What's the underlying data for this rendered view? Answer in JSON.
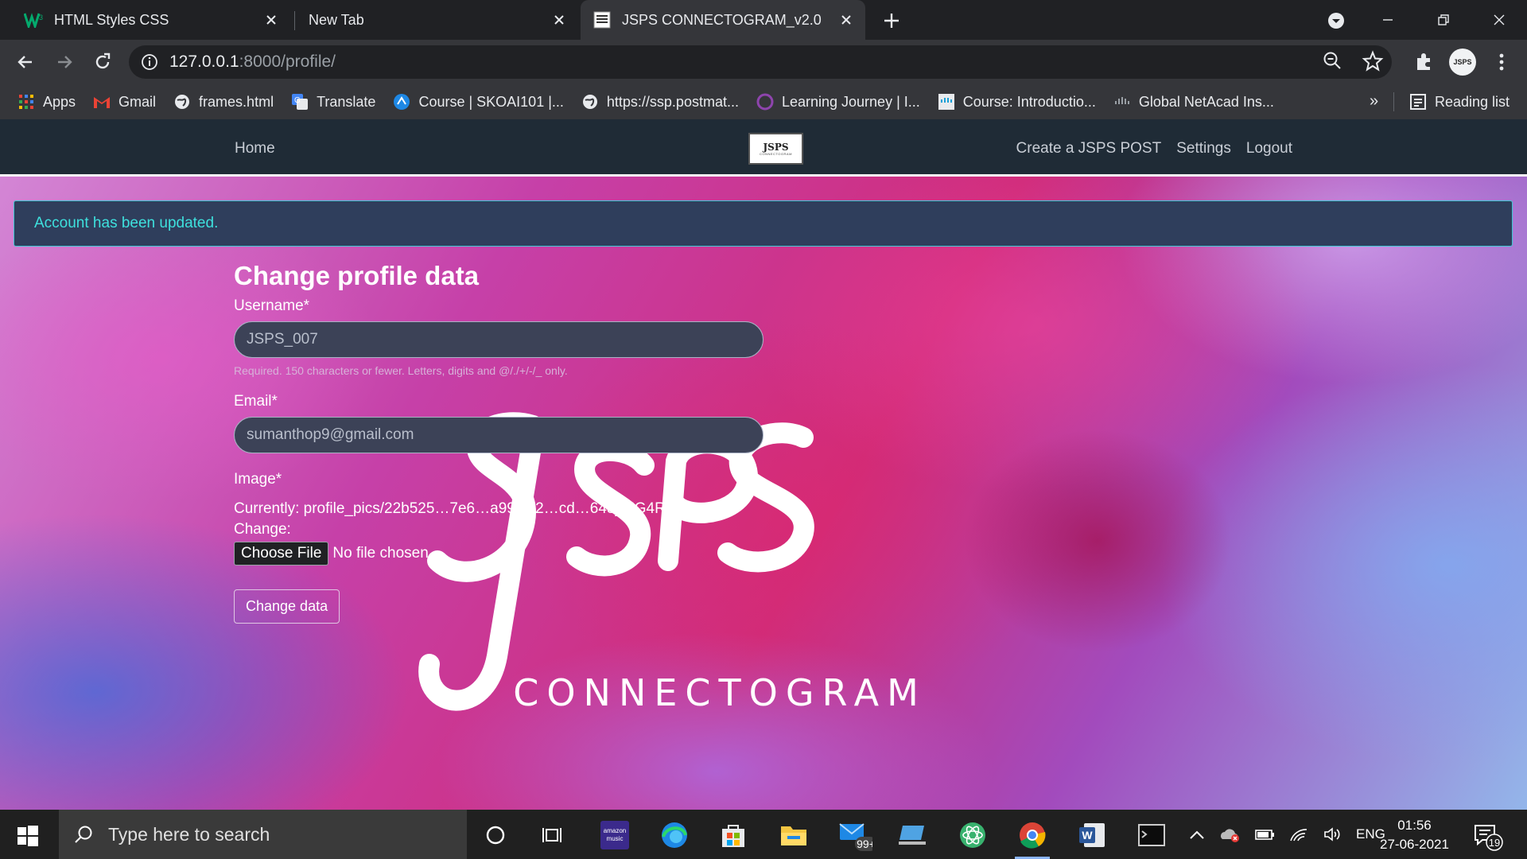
{
  "browser": {
    "tabs": [
      {
        "title": "HTML Styles CSS"
      },
      {
        "title": "New Tab"
      },
      {
        "title": "JSPS CONNECTOGRAM_v2.0"
      }
    ],
    "url_host": "127.0.0.1",
    "url_rest": ":8000/profile/",
    "bookmarks": [
      {
        "label": "Apps",
        "icon": "apps-grid-icon"
      },
      {
        "label": "Gmail",
        "icon": "gmail-icon"
      },
      {
        "label": "frames.html",
        "icon": "globe-icon"
      },
      {
        "label": "Translate",
        "icon": "translate-icon"
      },
      {
        "label": "Course | SKOAI101 |...",
        "icon": "course-icon"
      },
      {
        "label": "https://ssp.postmat...",
        "icon": "globe-icon"
      },
      {
        "label": "Learning Journey | I...",
        "icon": "learning-icon"
      },
      {
        "label": "Course: Introductio...",
        "icon": "cisco-icon"
      },
      {
        "label": "Global NetAcad Ins...",
        "icon": "netacad-icon"
      }
    ],
    "bookmarks_more": "»",
    "reading_list": "Reading list",
    "avatar_text": "JSPS"
  },
  "site": {
    "nav": {
      "home": "Home",
      "logo_text": "JSPS",
      "logo_sub": "CONNECTOGRAM",
      "create": "Create a JSPS POST",
      "settings": "Settings",
      "logout": "Logout"
    },
    "alert": "Account has been updated.",
    "watermark": {
      "big": "JSPS",
      "sub": "CONNECTOGRAM"
    },
    "form": {
      "title": "Change profile data",
      "username_label": "Username*",
      "username_value": "JSPS_007",
      "username_help": "Required. 150 characters or fewer. Letters, digits and @/./+/-/_ only.",
      "email_label": "Email*",
      "email_value": "sumanthop9@gmail.com",
      "image_label": "Image*",
      "currently_label": "Currently:",
      "currently_value": "profile_pics/22b525…7e6…a99-…2…cd…648_UG4RN…",
      "change_label": "Change:",
      "choose_file": "Choose File",
      "no_file": "No file chosen",
      "submit": "Change data"
    }
  },
  "taskbar": {
    "search_placeholder": "Type here to search",
    "mail_badge": "99+",
    "language": "ENG",
    "time": "01:56",
    "date": "27-06-2021",
    "notifications": "19"
  },
  "colors": {
    "navbar": "#1f2b36",
    "alert_bg": "#2f3e5c",
    "alert_text": "#3ee0dd",
    "input_bg": "#3c4257"
  }
}
